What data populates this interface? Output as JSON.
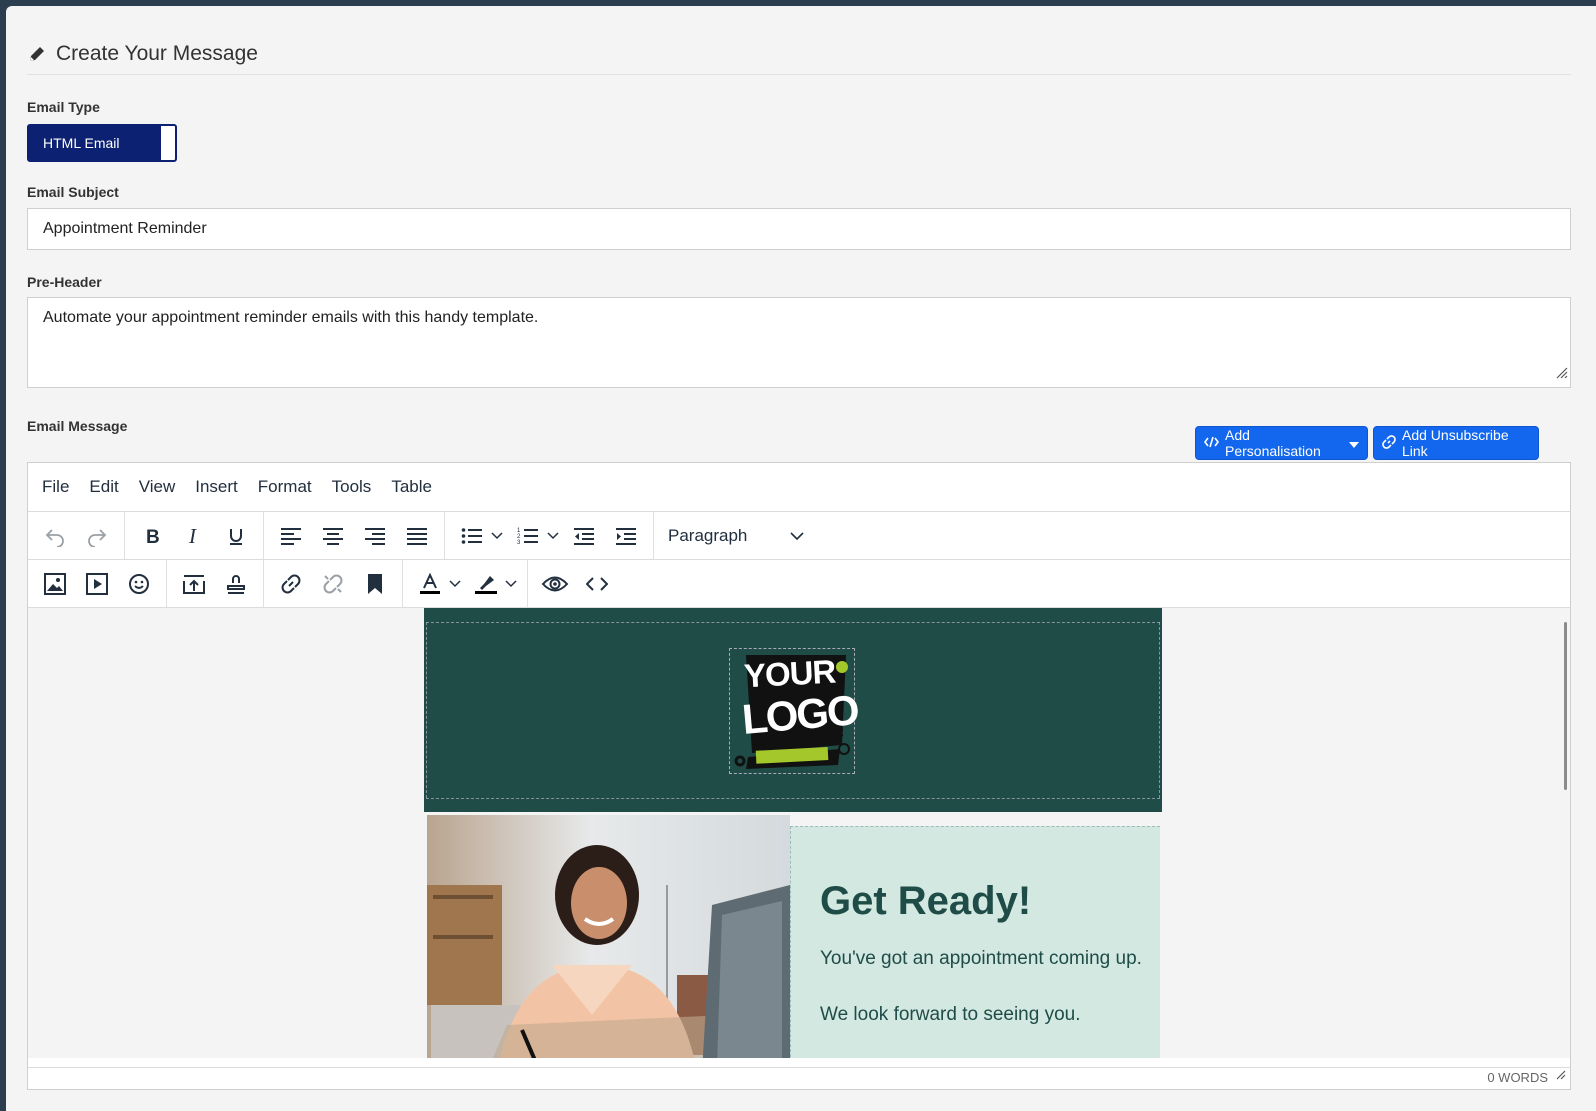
{
  "section": {
    "title": "Create Your Message"
  },
  "email_type": {
    "label": "Email Type",
    "value": "HTML Email"
  },
  "subject": {
    "label": "Email Subject",
    "value": "Appointment Reminder"
  },
  "preheader": {
    "label": "Pre-Header",
    "value": "Automate your appointment reminder emails with this handy template."
  },
  "message": {
    "label": "Email Message",
    "add_personalisation": "Add Personalisation",
    "add_unsubscribe": "Add Unsubscribe Link"
  },
  "editor": {
    "menu": [
      "File",
      "Edit",
      "View",
      "Insert",
      "Format",
      "Tools",
      "Table"
    ],
    "block_format": "Paragraph",
    "word_count": "0 WORDS"
  },
  "email_preview": {
    "logo_line1": "YOUR",
    "logo_line2": "LOGO",
    "heading": "Get Ready!",
    "line1": "You've got an appointment coming up.",
    "line2": "We look forward to seeing you."
  },
  "colors": {
    "primary_button": "#1367ef",
    "toggle": "#0c2172",
    "email_header_bg": "#1f4c47",
    "hero_text_bg": "#d3e8e1",
    "logo_accent": "#a4c82b"
  }
}
